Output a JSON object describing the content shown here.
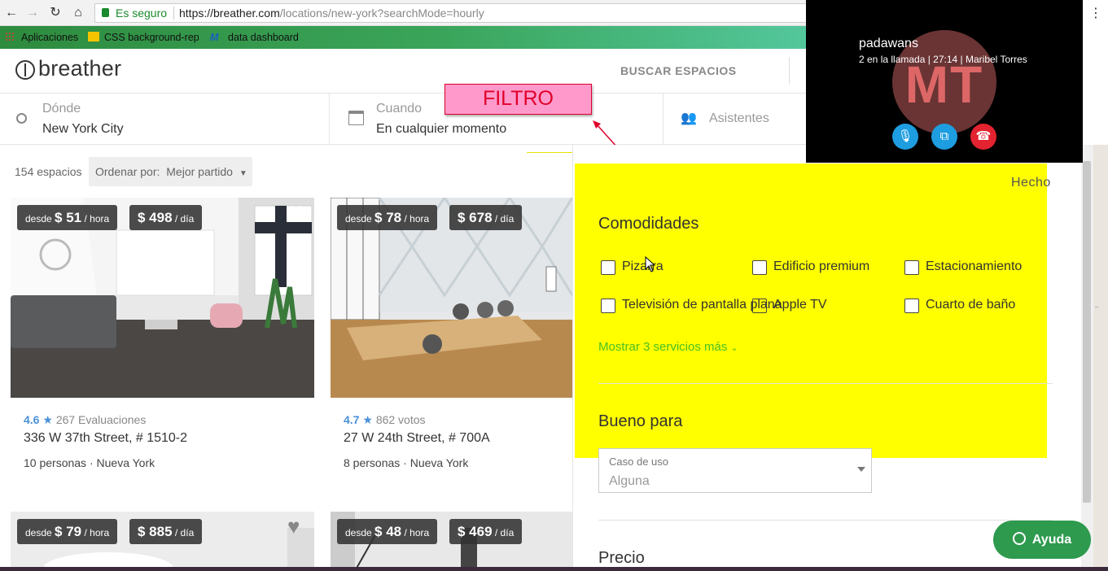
{
  "browser": {
    "secure_label": "Es seguro",
    "url_domain": "https://breather.com",
    "url_path": "/locations/new-york?searchMode=hourly",
    "bookmarks": [
      {
        "label": "Aplicaciones"
      },
      {
        "label": "CSS background-repe"
      },
      {
        "label": "data dashboard"
      }
    ]
  },
  "header": {
    "logo_text": "breather",
    "nav_label": "BUSCAR ESPACIOS"
  },
  "search": {
    "where_label": "Dónde",
    "where_value": "New York City",
    "when_label": "Cuando",
    "when_value": "En cualquier momento",
    "guests_label": "Asistentes"
  },
  "annotation": {
    "label": "FILTRO",
    "color": "#ff99cc",
    "border": "#e0002a"
  },
  "results": {
    "count_label": "154 espacios",
    "sort_label": "Ordenar por:",
    "sort_value": "Mejor partido"
  },
  "listings": [
    {
      "from": "desde",
      "hourly": "$ 51",
      "per_hour": "/ hora",
      "daily": "$ 498",
      "per_day": "/ día",
      "rating": "4.6",
      "reviews": "267 Evaluaciones",
      "title": "336 W 37th Street, # 1510-2",
      "capacity": "10 personas",
      "city": "Nueva York"
    },
    {
      "from": "desde",
      "hourly": "$ 78",
      "per_hour": "/ hora",
      "daily": "$ 678",
      "per_day": "/ día",
      "rating": "4.7",
      "reviews": "862 votos",
      "title": "27 W 24th Street, # 700A",
      "capacity": "8 personas",
      "city": "Nueva York"
    },
    {
      "from": "desde",
      "hourly": "$ 79",
      "per_hour": "/ hora",
      "daily": "$ 885",
      "per_day": "/ día"
    },
    {
      "from": "desde",
      "hourly": "$ 48",
      "per_hour": "/ hora",
      "daily": "$ 469",
      "per_day": "/ día"
    }
  ],
  "filters": {
    "done_label": "Hecho",
    "amenities_title": "Comodidades",
    "amenities": [
      {
        "label": "Pizarra",
        "checked": false
      },
      {
        "label": "Edificio premium",
        "checked": false
      },
      {
        "label": "Estacionamiento",
        "checked": false
      },
      {
        "label": "Televisión de pantalla plana",
        "checked": false
      },
      {
        "label": "Apple TV",
        "checked": false
      },
      {
        "label": "Cuarto de baño",
        "checked": false
      }
    ],
    "show_more_label": "Mostrar 3 servicios más",
    "good_for_title": "Bueno para",
    "use_case_label": "Caso de uso",
    "use_case_value": "Alguna",
    "price_title": "Precio",
    "highlight_color": "#ffff00"
  },
  "skype": {
    "contact_name": "padawans",
    "call_info": "2 en la llamada | 27:14 | Maribel Torres",
    "avatar_initials": "MT"
  },
  "help": {
    "label": "Ayuda"
  },
  "colors": {
    "accent_green": "#2e9a4e",
    "link_green": "#4cc021",
    "rating_blue": "#4a90d9"
  }
}
